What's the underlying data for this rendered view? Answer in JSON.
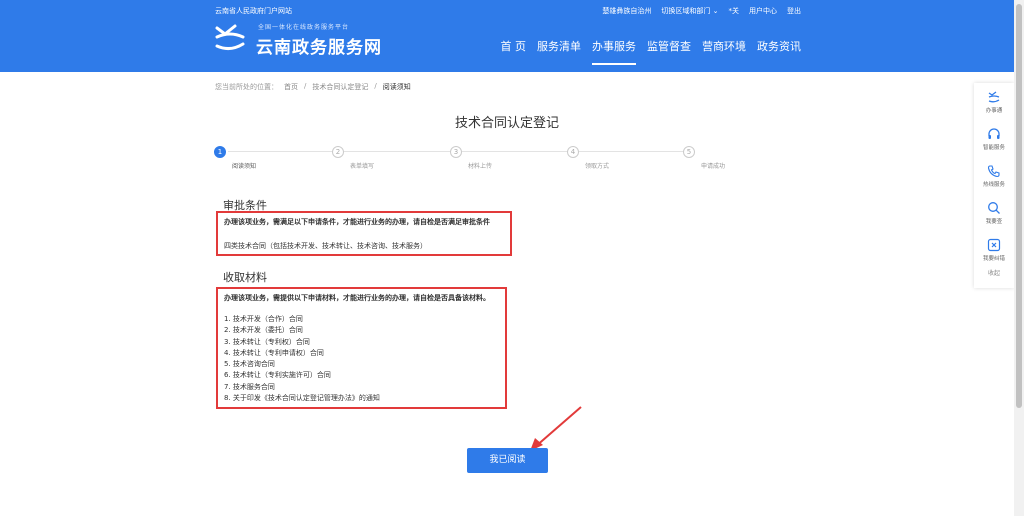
{
  "header": {
    "gov_link": "云南省人民政府门户网站",
    "region": "楚雄彝族自治州",
    "switch_region": "切换区域和部门",
    "care_mode": "*关",
    "user_center": "用户中心",
    "logout": "登出",
    "logo_subtitle": "全国一体化在线政务服务平台",
    "logo_title": "云南政务服务网",
    "nav": [
      "首 页",
      "服务清单",
      "办事服务",
      "监管督查",
      "营商环境",
      "政务资讯"
    ]
  },
  "breadcrumb": {
    "prefix": "您当前所处的位置：",
    "items": [
      "首页",
      "技术合同认定登记",
      "阅读须知"
    ]
  },
  "page_title": "技术合同认定登记",
  "steps": [
    {
      "num": "1",
      "label": "阅读须知"
    },
    {
      "num": "2",
      "label": "表单填写"
    },
    {
      "num": "3",
      "label": "材料上传"
    },
    {
      "num": "4",
      "label": "领取方式"
    },
    {
      "num": "5",
      "label": "申请成功"
    }
  ],
  "approval": {
    "title": "审批条件",
    "requirement": "办理该项业务，需满足以下申请条件，才能进行业务的办理，请自检是否满足审批条件",
    "content": "四类技术合同（包括技术开发、技术转让、技术咨询、技术服务）"
  },
  "materials": {
    "title": "收取材料",
    "requirement": "办理该项业务，需提供以下申请材料，才能进行业务的办理，请自检是否具备该材料。",
    "items": [
      "1. 技术开发（合作）合同",
      "2. 技术开发（委托）合同",
      "3. 技术转让（专利权）合同",
      "4. 技术转让（专利申请权）合同",
      "5. 技术咨询合同",
      "6. 技术转让（专利实施许可）合同",
      "7. 技术服务合同",
      "8. 关于印发《技术合同认定登记管理办法》的通知"
    ]
  },
  "read_button": "我已阅读",
  "sidebar": {
    "items": [
      {
        "label": "办事通",
        "icon": "app-logo-icon"
      },
      {
        "label": "智能服务",
        "icon": "headset-icon"
      },
      {
        "label": "热线服务",
        "icon": "phone-icon"
      },
      {
        "label": "我要查",
        "icon": "search-icon"
      },
      {
        "label": "我要纠错",
        "icon": "error-report-icon"
      }
    ],
    "collapse": "收起"
  },
  "colors": {
    "primary": "#2f7be9",
    "highlight_border": "#e23a3a",
    "annotation_arrow": "#e23a3a"
  }
}
